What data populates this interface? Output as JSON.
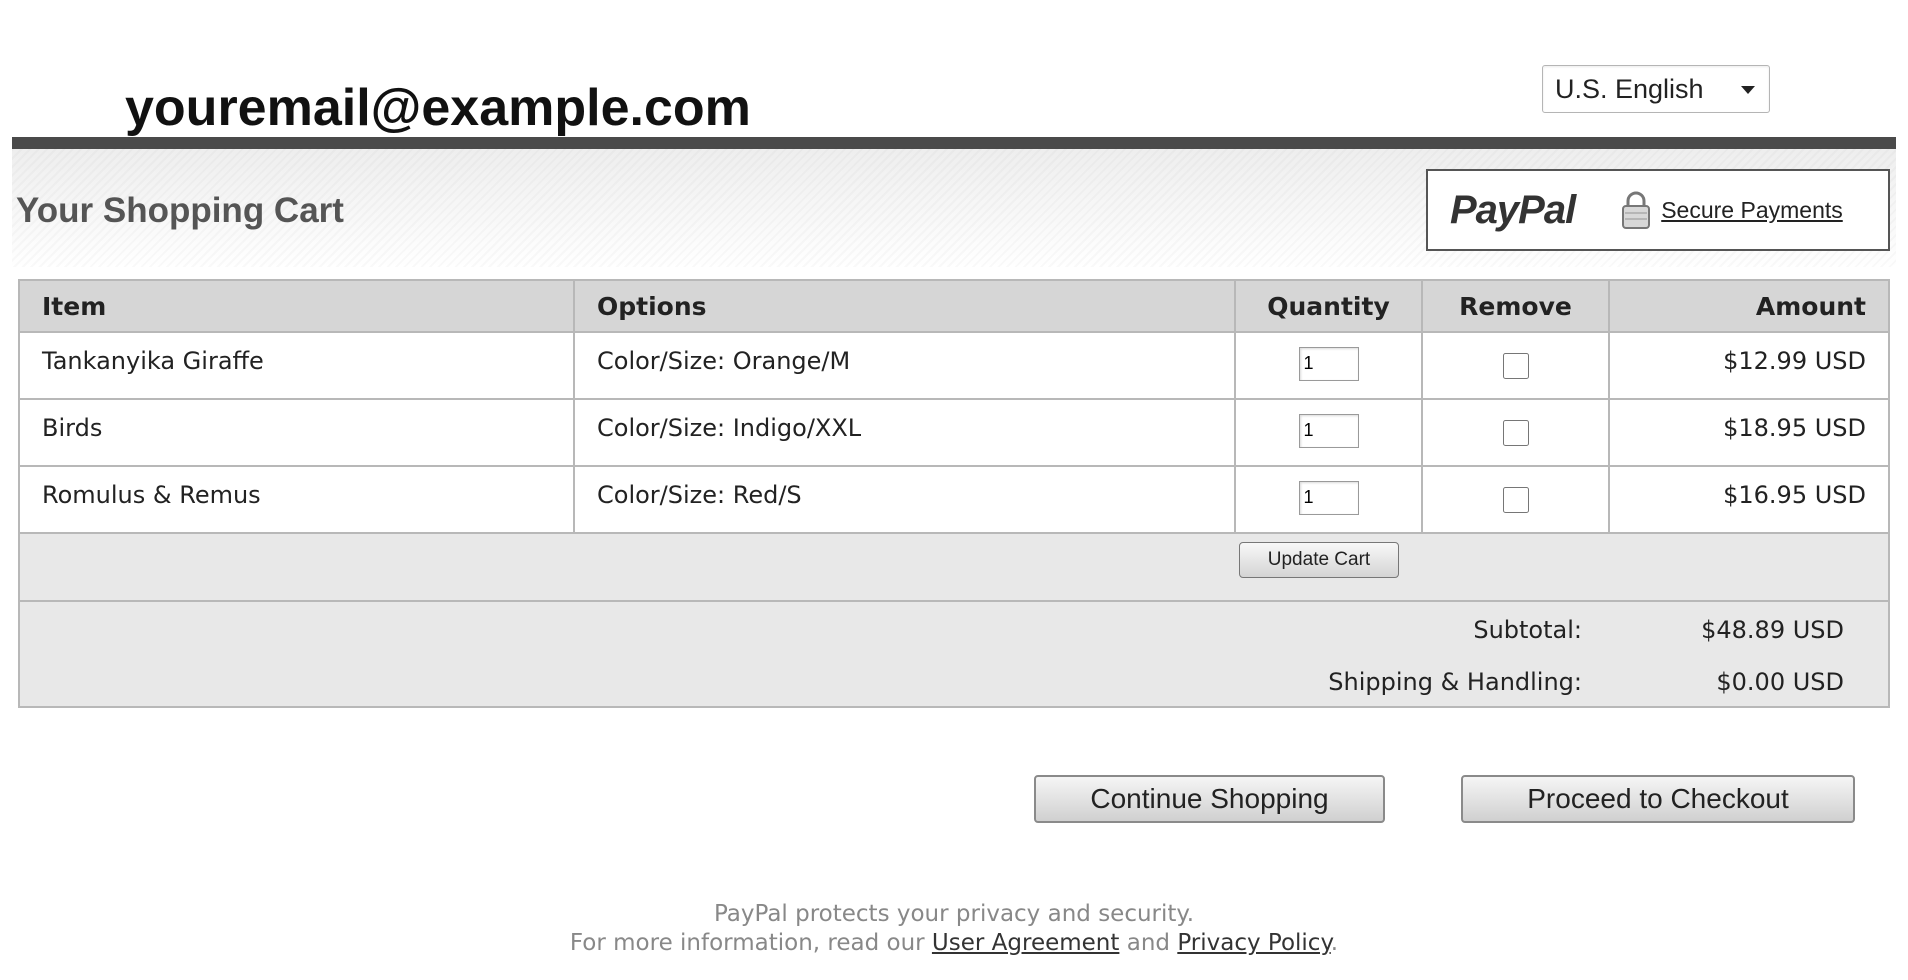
{
  "header": {
    "merchant_email": "youremail@example.com",
    "language": {
      "selected": "U.S. English",
      "icon": "chevron-down-icon"
    }
  },
  "cart": {
    "title": "Your Shopping Cart",
    "branding": {
      "logo_text": "PayPal",
      "secure_icon": "lock-icon",
      "secure_label": "Secure Payments"
    },
    "columns": {
      "item": "Item",
      "options": "Options",
      "quantity": "Quantity",
      "remove": "Remove",
      "amount": "Amount"
    },
    "rows": [
      {
        "item": "Tankanyika Giraffe",
        "options": "Color/Size: Orange/M",
        "quantity": "1",
        "remove": false,
        "amount": "$12.99 USD"
      },
      {
        "item": "Birds",
        "options": "Color/Size: Indigo/XXL",
        "quantity": "1",
        "remove": false,
        "amount": "$18.95 USD"
      },
      {
        "item": "Romulus & Remus",
        "options": "Color/Size: Red/S",
        "quantity": "1",
        "remove": false,
        "amount": "$16.95 USD"
      }
    ],
    "update_label": "Update Cart",
    "totals": {
      "subtotal_label": "Subtotal:",
      "subtotal_value": "$48.89 USD",
      "shipping_label": "Shipping & Handling:",
      "shipping_value": "$0.00 USD"
    }
  },
  "actions": {
    "continue_label": "Continue Shopping",
    "checkout_label": "Proceed to Checkout"
  },
  "footer": {
    "line1": "PayPal protects your privacy and security.",
    "line2_prefix": "For more information, read our",
    "user_agreement": "User Agreement",
    "and": "and",
    "privacy_policy": "Privacy Policy",
    "period": "."
  },
  "colors": {
    "header_bar": "#4a4a4a",
    "table_header": "#d6d6d6",
    "table_footer": "#e8e8e8",
    "border": "#b8b8b8"
  }
}
